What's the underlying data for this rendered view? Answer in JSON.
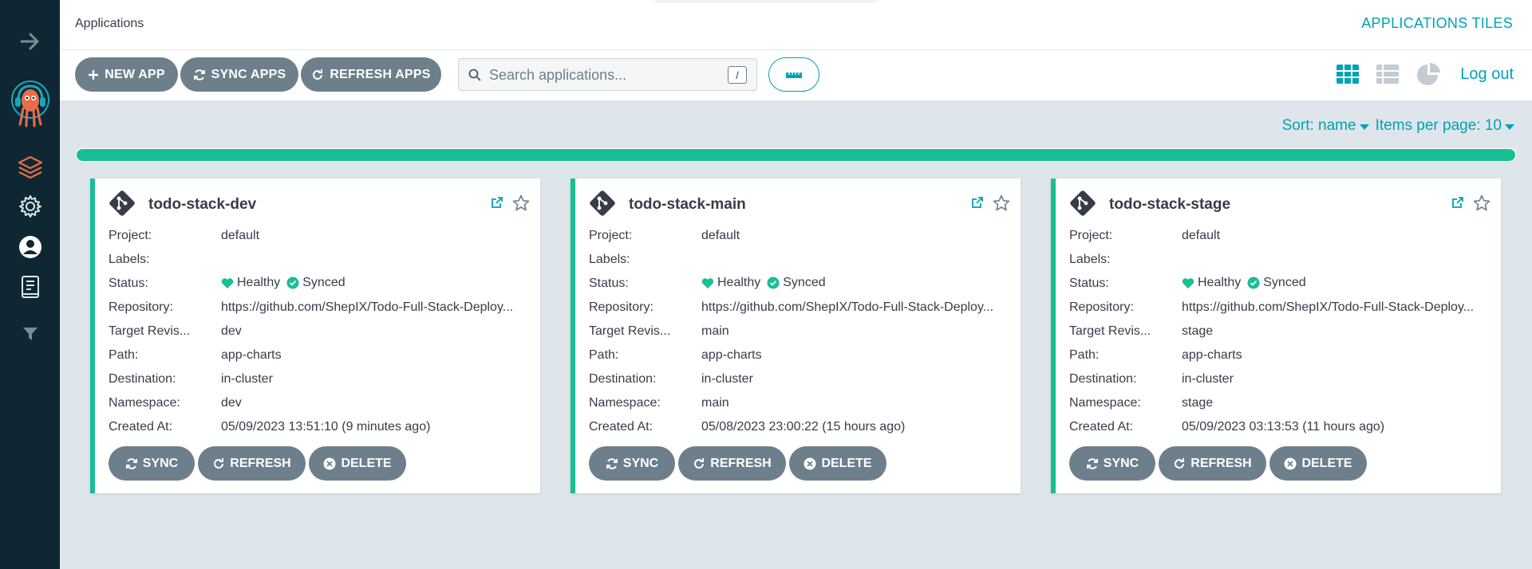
{
  "header": {
    "breadcrumb": "Applications",
    "view_title": "APPLICATIONS TILES"
  },
  "toolbar": {
    "new_app": "NEW APP",
    "sync_apps": "SYNC APPS",
    "refresh_apps": "REFRESH APPS",
    "search_placeholder": "Search applications...",
    "search_shortcut": "/",
    "logout": "Log out"
  },
  "sort": {
    "sort_label": "Sort: name",
    "items_label": "Items per page: 10"
  },
  "status_summary": {
    "healthy_fraction": 1.0
  },
  "card_labels": {
    "project": "Project:",
    "labels": "Labels:",
    "status": "Status:",
    "repository": "Repository:",
    "target_revision": "Target Revis...",
    "path": "Path:",
    "destination": "Destination:",
    "namespace": "Namespace:",
    "created_at": "Created At:",
    "sync": "SYNC",
    "refresh": "REFRESH",
    "delete": "DELETE"
  },
  "apps": [
    {
      "name": "todo-stack-dev",
      "project": "default",
      "labels": "",
      "health": "Healthy",
      "sync": "Synced",
      "repository": "https://github.com/ShepIX/Todo-Full-Stack-Deploy...",
      "target_revision": "dev",
      "path": "app-charts",
      "destination": "in-cluster",
      "namespace": "dev",
      "created_at": "05/09/2023 13:51:10  (9 minutes ago)"
    },
    {
      "name": "todo-stack-main",
      "project": "default",
      "labels": "",
      "health": "Healthy",
      "sync": "Synced",
      "repository": "https://github.com/ShepIX/Todo-Full-Stack-Deploy...",
      "target_revision": "main",
      "path": "app-charts",
      "destination": "in-cluster",
      "namespace": "main",
      "created_at": "05/08/2023 23:00:22  (15 hours ago)"
    },
    {
      "name": "todo-stack-stage",
      "project": "default",
      "labels": "",
      "health": "Healthy",
      "sync": "Synced",
      "repository": "https://github.com/ShepIX/Todo-Full-Stack-Deploy...",
      "target_revision": "stage",
      "path": "app-charts",
      "destination": "in-cluster",
      "namespace": "stage",
      "created_at": "05/09/2023 03:13:53  (11 hours ago)"
    }
  ],
  "colors": {
    "accent": "#00a2b3",
    "healthy": "#18be94",
    "sidebar": "#0f2733",
    "button": "#6d7f8b",
    "active_nav": "#e96d4b"
  },
  "icons": {
    "sidebar": [
      "arrow-right-icon",
      "argo-logo-icon",
      "layers-icon",
      "gear-icon",
      "user-icon",
      "docs-icon",
      "filter-icon"
    ]
  }
}
